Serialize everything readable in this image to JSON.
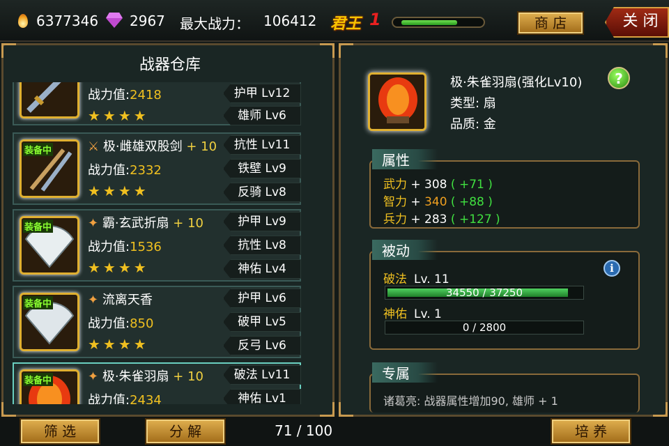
{
  "header": {
    "gold": "6377346",
    "gems": "2967",
    "max_power_label": "最大战力：",
    "max_power_value": "106412",
    "rank_name": "君王",
    "rank_level": "1",
    "rank_progress": 0.75,
    "shop_label": "商 店",
    "close_label": "关 闭"
  },
  "warehouse": {
    "title": "战器仓库",
    "power_label": "战力值:",
    "items": [
      {
        "name": "",
        "plus": "",
        "equipped": false,
        "power": "2418",
        "stars": "★★★★",
        "attrs": [
          "护甲  Lv12",
          "雄师  Lv6"
        ]
      },
      {
        "name": "极·雌雄双股剑",
        "plus": "+ 10",
        "equipped": true,
        "power": "2332",
        "stars": "★★★★",
        "attrs": [
          "抗性  Lv11",
          "铁壁  Lv9",
          "反骑  Lv8"
        ]
      },
      {
        "name": "霸·玄武折扇",
        "plus": "+ 10",
        "equipped": true,
        "power": "1536",
        "stars": "★★★★",
        "attrs": [
          "护甲  Lv9",
          "抗性  Lv8",
          "神佑  Lv4"
        ]
      },
      {
        "name": "流离天香",
        "plus": "",
        "equipped": true,
        "power": "850",
        "stars": "★★★★",
        "attrs": [
          "护甲  Lv6",
          "破甲  Lv5",
          "反弓  Lv6"
        ]
      },
      {
        "name": "极·朱雀羽扇",
        "plus": "+ 10",
        "equipped": true,
        "power": "2434",
        "stars": "",
        "attrs": [
          "破法  Lv11",
          "神佑  Lv1"
        ]
      }
    ],
    "equipped_tag": "装备中"
  },
  "bottom": {
    "filter_label": "筛 选",
    "decompose_label": "分 解",
    "count": "71 / 100",
    "cultivate_label": "培 养"
  },
  "detail": {
    "name": "极·朱雀羽扇(强化Lv10)",
    "type": "类型: 扇",
    "quality": "品质: 金",
    "help_icon": "?",
    "attributes_title": "属性",
    "attributes": [
      {
        "key": "武力",
        "base": "+ 308",
        "value_class": "",
        "bonus": "( +71 )"
      },
      {
        "key": "智力",
        "base": "+ 340",
        "value_class": "v2",
        "bonus": "( +88 )"
      },
      {
        "key": "兵力",
        "base": "+ 283",
        "value_class": "",
        "bonus": "( +127 )"
      }
    ],
    "passive_title": "被动",
    "info_icon": "i",
    "skills": [
      {
        "name": "破法",
        "level": "Lv.  11",
        "progress_text": "34550 / 37250",
        "progress": 0.93
      },
      {
        "name": "神佑",
        "level": "Lv.  1",
        "progress_text": "0 / 2800",
        "progress": 0.0
      }
    ],
    "exclusive_title": "专属",
    "exclusive_text": "诸葛亮: 战器属性增加90, 雄师 + 1"
  },
  "colors": {
    "accent_gold": "#f0c020",
    "bonus_green": "#40e040",
    "panel_border": "#5a4a2e"
  }
}
